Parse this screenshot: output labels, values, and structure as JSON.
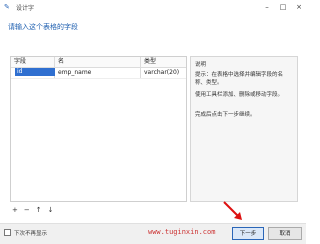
{
  "window": {
    "title": "设计字"
  },
  "header": {
    "text": "请输入这个表格的字段"
  },
  "grid": {
    "columns": [
      "字段",
      "名",
      "类型"
    ],
    "rows": [
      {
        "field": "id",
        "name": "emp_name",
        "type": "varchar(20)"
      }
    ]
  },
  "side_panel": {
    "heading": "说明",
    "p1": "提示：在表格中选择并编辑字段的名称、类型。",
    "p2": "使用工具栏添加、删除或移动字段。",
    "p3": "完成后点击下一步继续。"
  },
  "tools": {
    "add": "+",
    "remove": "−",
    "up": "↑",
    "down": "↓"
  },
  "bottom": {
    "open_label": "下次不再显示",
    "watermark": "www.tuginxin.com",
    "next_label": "下一步",
    "cancel_label": "取消"
  }
}
